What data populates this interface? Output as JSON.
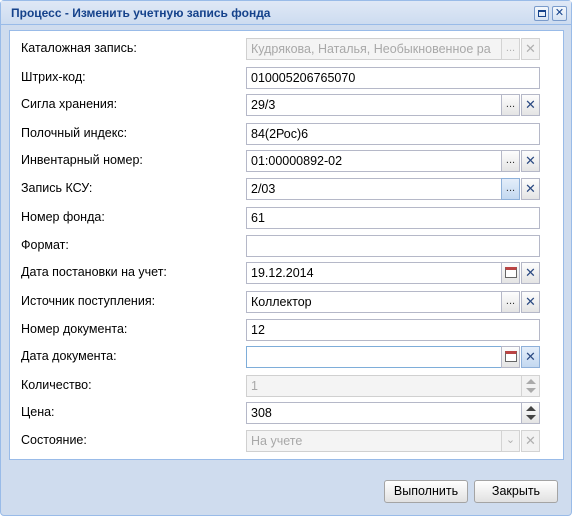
{
  "window": {
    "title": "Процесс - Изменить учетную запись фонда",
    "max_icon": "maximize-icon",
    "close_icon": "close-icon",
    "close_glyph": "✕"
  },
  "form": {
    "catalog": {
      "label": "Каталожная запись:",
      "value": "Кудрякова, Наталья, Необыкновенное ра"
    },
    "barcode": {
      "label": "Штрих-код:",
      "value": "010005206765070"
    },
    "storage": {
      "label": "Сигла хранения:",
      "value": "29/3"
    },
    "shelf": {
      "label": "Полочный индекс:",
      "value": "84(2Рос)6"
    },
    "inventory": {
      "label": "Инвентарный номер:",
      "value": "01:00000892-02"
    },
    "ksu": {
      "label": "Запись КСУ:",
      "value": "2/03"
    },
    "fund_number": {
      "label": "Номер фонда:",
      "value": "61"
    },
    "format": {
      "label": "Формат:",
      "value": ""
    },
    "reg_date": {
      "label": "Дата постановки на учет:",
      "value": "19.12.2014"
    },
    "source": {
      "label": "Источник поступления:",
      "value": "Коллектор"
    },
    "doc_number": {
      "label": "Номер документа:",
      "value": "12"
    },
    "doc_date": {
      "label": "Дата документа:",
      "value": ""
    },
    "quantity": {
      "label": "Количество:",
      "value": "1"
    },
    "price": {
      "label": "Цена:",
      "value": "308"
    },
    "state": {
      "label": "Состояние:",
      "value": "На учете"
    }
  },
  "glyphs": {
    "dots": "...",
    "clear": "✕",
    "chevron": "⌄"
  },
  "footer": {
    "run_label": "Выполнить",
    "close_label": "Закрыть"
  }
}
